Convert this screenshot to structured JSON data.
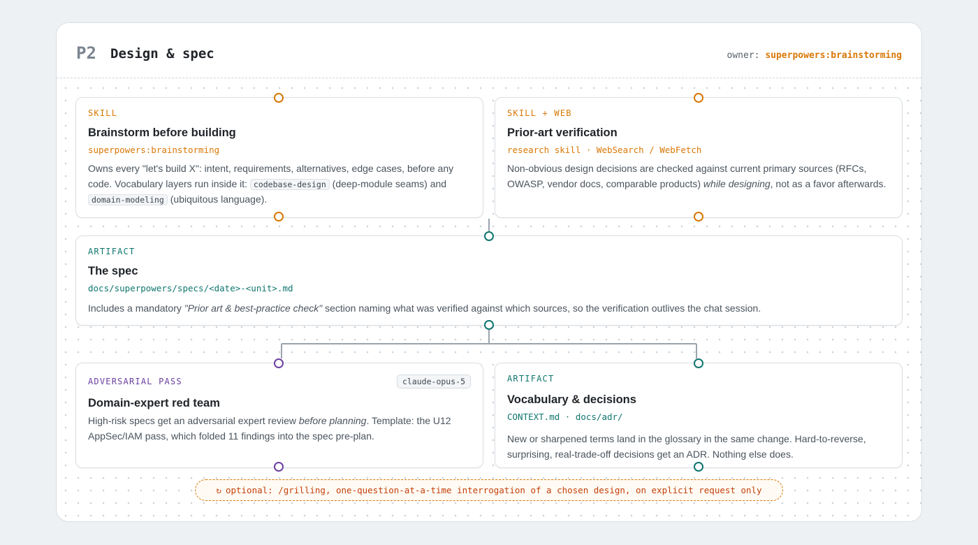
{
  "header": {
    "phase_id": "P2",
    "title": "Design & spec",
    "owner_label": "owner:",
    "owner_value": "superpowers:brainstorming"
  },
  "cards": {
    "brainstorm": {
      "kicker": "SKILL",
      "title": "Brainstorm before building",
      "sub": "superpowers:brainstorming",
      "body_1": "Owns every \"let's build X\": intent, requirements, alternatives, edge cases, before any code. Vocabulary layers run inside it: ",
      "code_1": "codebase-design",
      "body_2": " (deep-module seams) and ",
      "code_2": "domain-modeling",
      "body_3": " (ubiquitous language)."
    },
    "prior_art": {
      "kicker": "SKILL + WEB",
      "title": "Prior-art verification",
      "sub": "research skill · WebSearch / WebFetch",
      "body_1": "Non-obvious design decisions are checked against current primary sources (RFCs, OWASP, vendor docs, comparable products) ",
      "em": "while designing",
      "body_2": ", not as a favor afterwards."
    },
    "spec": {
      "kicker": "ARTIFACT",
      "title": "The spec",
      "sub": "docs/superpowers/specs/<date>-<unit>.md",
      "body_1": "Includes a mandatory ",
      "em": "\"Prior art & best-practice check\"",
      "body_2": " section naming what was verified against which sources, so the verification outlives the chat session."
    },
    "red_team": {
      "kicker": "ADVERSARIAL PASS",
      "badge": "claude-opus-5",
      "title": "Domain-expert red team",
      "body_1": "High-risk specs get an adversarial expert review ",
      "em": "before planning",
      "body_2": ". Template: the U12 AppSec/IAM pass, which folded 11 findings into the spec pre-plan."
    },
    "vocab": {
      "kicker": "ARTIFACT",
      "title": "Vocabulary & decisions",
      "sub": "CONTEXT.md · docs/adr/",
      "body": "New or sharpened terms land in the glossary in the same change. Hard-to-reverse, surprising, real-trade-off decisions get an ADR. Nothing else does."
    }
  },
  "optional": {
    "icon": "loop-arrow-icon",
    "glyph": "↻",
    "text": "optional: /grilling, one-question-at-a-time interrogation of a chosen design, on explicit request only"
  },
  "colors": {
    "skill": "#d97706",
    "artifact": "#0f766e",
    "adversarial": "#6b3fa0",
    "wire": "#9aa3ad"
  }
}
